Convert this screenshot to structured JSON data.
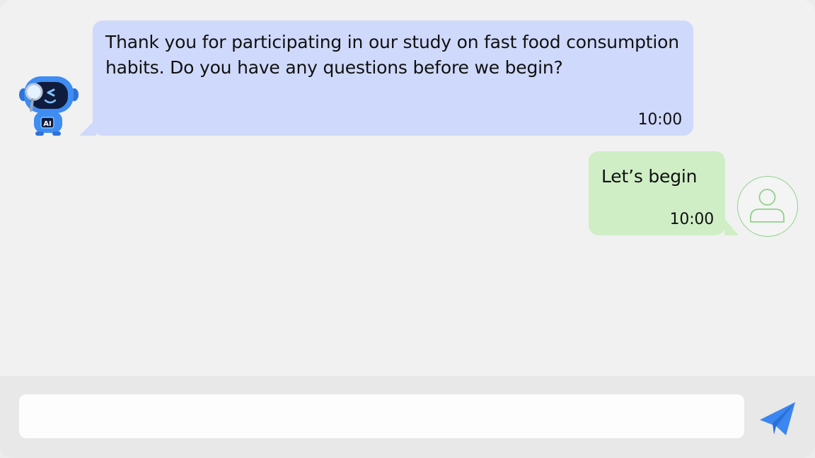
{
  "colors": {
    "bot_bubble": "#cfd9fb",
    "user_bubble": "#cfeec6",
    "accent": "#3b86f0",
    "avatar_outline": "#8fd28a",
    "background": "#f1f1f1"
  },
  "messages": [
    {
      "sender": "bot",
      "avatar_icon": "robot-assistant-icon",
      "text": "Thank you for participating in our study on fast food consumption habits. Do you have any questions before we begin?",
      "time": "10:00"
    },
    {
      "sender": "user",
      "avatar_icon": "user-icon",
      "text": "Let’s begin",
      "time": "10:00"
    }
  ],
  "bot_avatar_badge": "AI",
  "composer": {
    "value": "",
    "placeholder": "",
    "send_icon": "send-icon"
  }
}
